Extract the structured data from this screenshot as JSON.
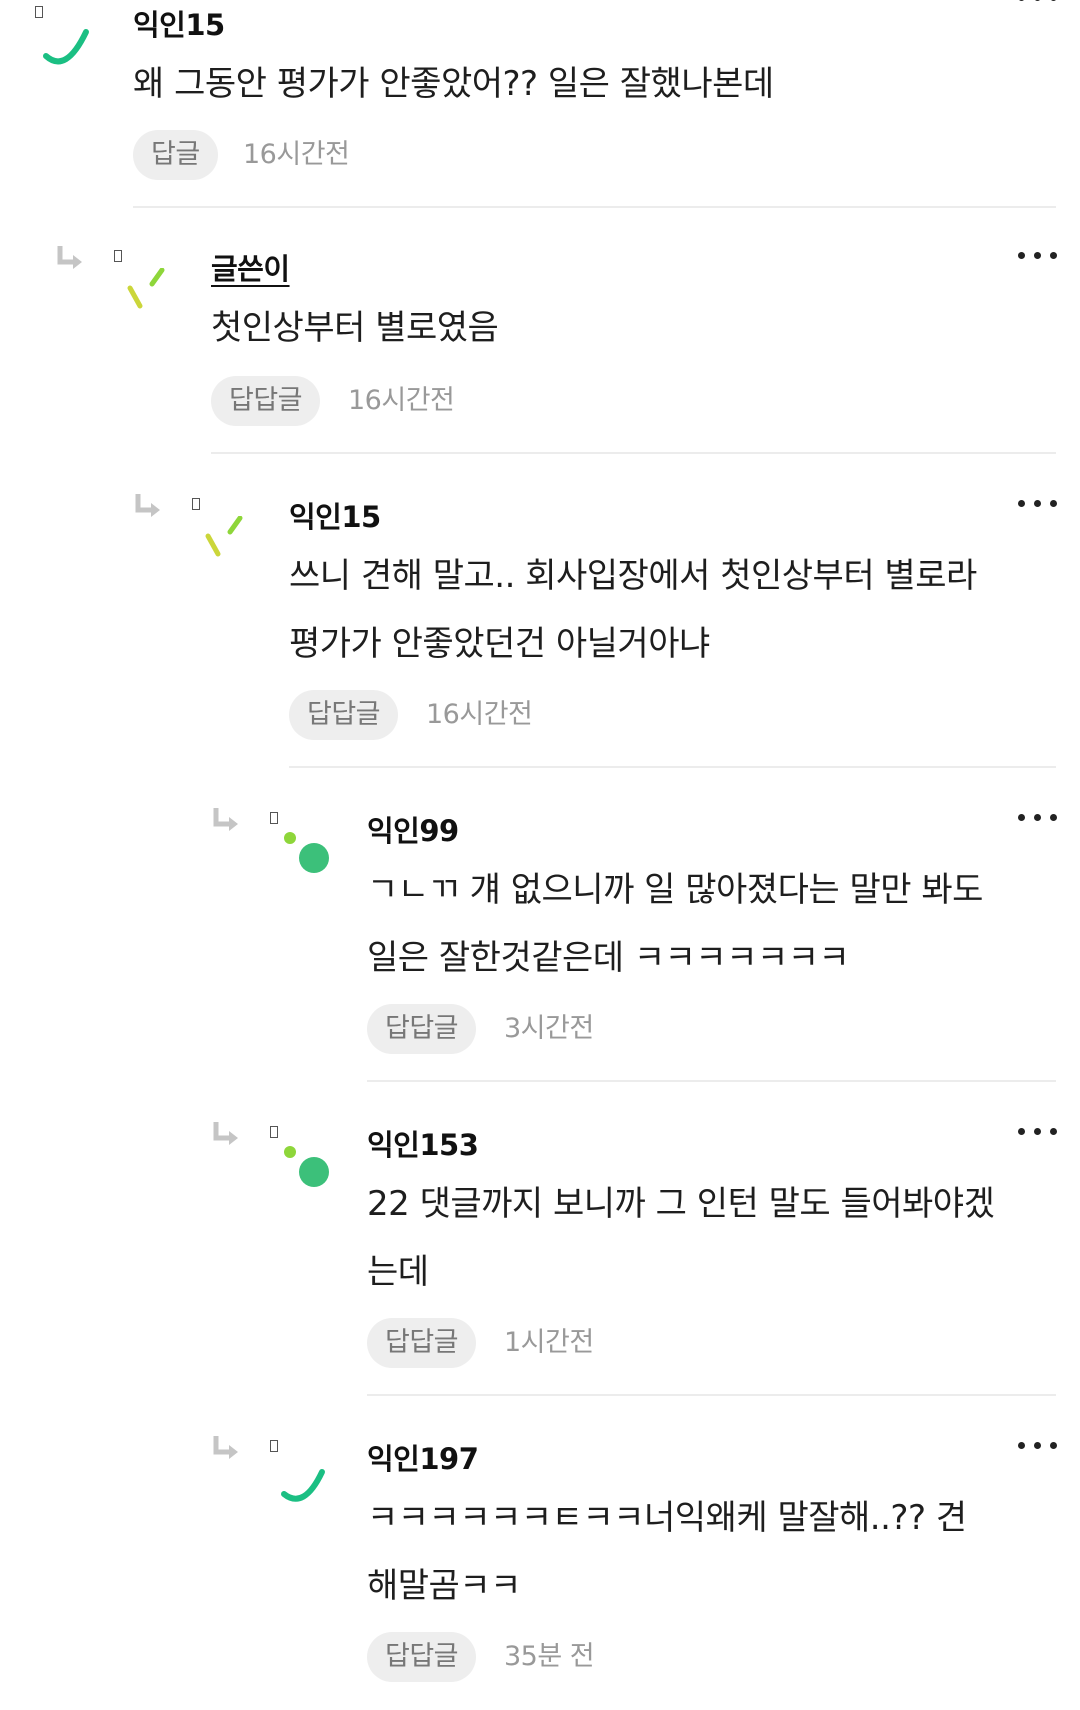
{
  "comments": [
    {
      "author": "익인15",
      "text_lines": [
        "왜 그동안 평가가 안좋았어?? 일은 잘했나본데"
      ],
      "reply_label": "답글",
      "time": "16시간전",
      "avatar_style": "arc-green",
      "is_reply": false
    },
    {
      "author": "글쓴이",
      "text_lines": [
        "첫인상부터 별로였음"
      ],
      "reply_label": "답답글",
      "time": "16시간전",
      "avatar_style": "dashes-yellow-green",
      "is_reply": true
    },
    {
      "author": "익인15",
      "text_lines": [
        "쓰니 견해 말고.. 회사입장에서 첫인상부터 별로라",
        "평가가 안좋았던건 아닐거아냐"
      ],
      "reply_label": "답답글",
      "time": "16시간전",
      "avatar_style": "dashes-yellow-green",
      "is_reply": true
    },
    {
      "author": "익인99",
      "text_lines": [
        "ㄱㄴㄲ 걔 없으니까 일 많아졌다는 말만 봐도",
        "일은 잘한것같은데 ㅋㅋㅋㅋㅋㅋㅋ"
      ],
      "reply_label": "답답글",
      "time": "3시간전",
      "avatar_style": "dots-green",
      "is_reply": true
    },
    {
      "author": "익인153",
      "text_lines": [
        "22 댓글까지 보니까 그 인턴 말도 들어봐야겠",
        "는데"
      ],
      "reply_label": "답답글",
      "time": "1시간전",
      "avatar_style": "dots-green",
      "is_reply": true
    },
    {
      "author": "익인197",
      "text_lines": [
        "ㅋㅋㅋㅋㅋㅋㅌㅋㅋ너익왜케 말잘해..?? 견",
        "해말곰ㅋㅋ"
      ],
      "reply_label": "답답글",
      "time": "35분 전",
      "avatar_style": "arc-green",
      "is_reply": true
    }
  ],
  "colors": {
    "accent_green": "#1bbf83",
    "lime": "#8ed63a",
    "yellow_green": "#cbd63a",
    "reply_pill_bg": "#eeeeee",
    "divider": "#ececec"
  },
  "icons": {
    "reply_arrow": "reply-arrow-icon",
    "more": "more-dots-icon",
    "broken_image": "broken-image-icon"
  }
}
